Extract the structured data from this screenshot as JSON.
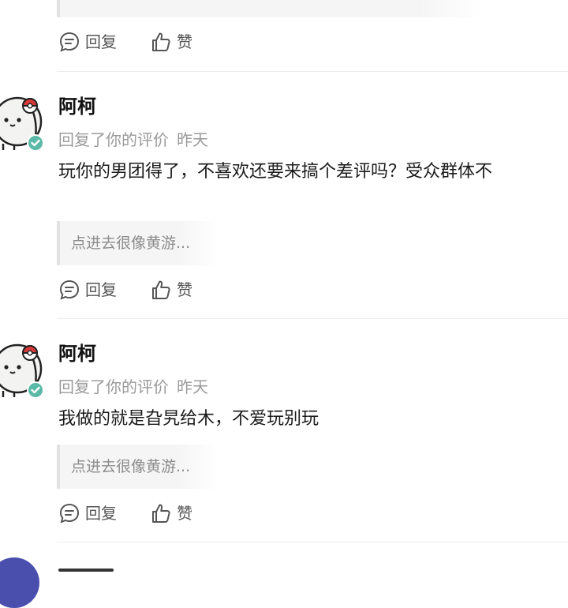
{
  "actions": {
    "reply_label": "回复",
    "like_label": "赞"
  },
  "comments": [
    {
      "username": "阿柯",
      "action_text": "回复了你的评价",
      "time": "昨天",
      "text": "玩你的男团得了，不喜欢还要来搞个差评吗？受众群体不",
      "quote": "点进去很像黄游..."
    },
    {
      "username": "阿柯",
      "action_text": "回复了你的评价",
      "time": "昨天",
      "text": "我做的就是旮旯给木，不爱玩别玩",
      "quote": "点进去很像黄游..."
    }
  ],
  "icons": {
    "reply": "comment-bubble-icon",
    "like": "thumbs-up-icon",
    "verified": "verified-check-icon",
    "avatar": "pokeball-character-avatar"
  },
  "colors": {
    "verified": "#5bb9a8",
    "meta_text": "#9a9a9a",
    "quote_bg": "#f5f5f5",
    "divider": "#ececec"
  }
}
